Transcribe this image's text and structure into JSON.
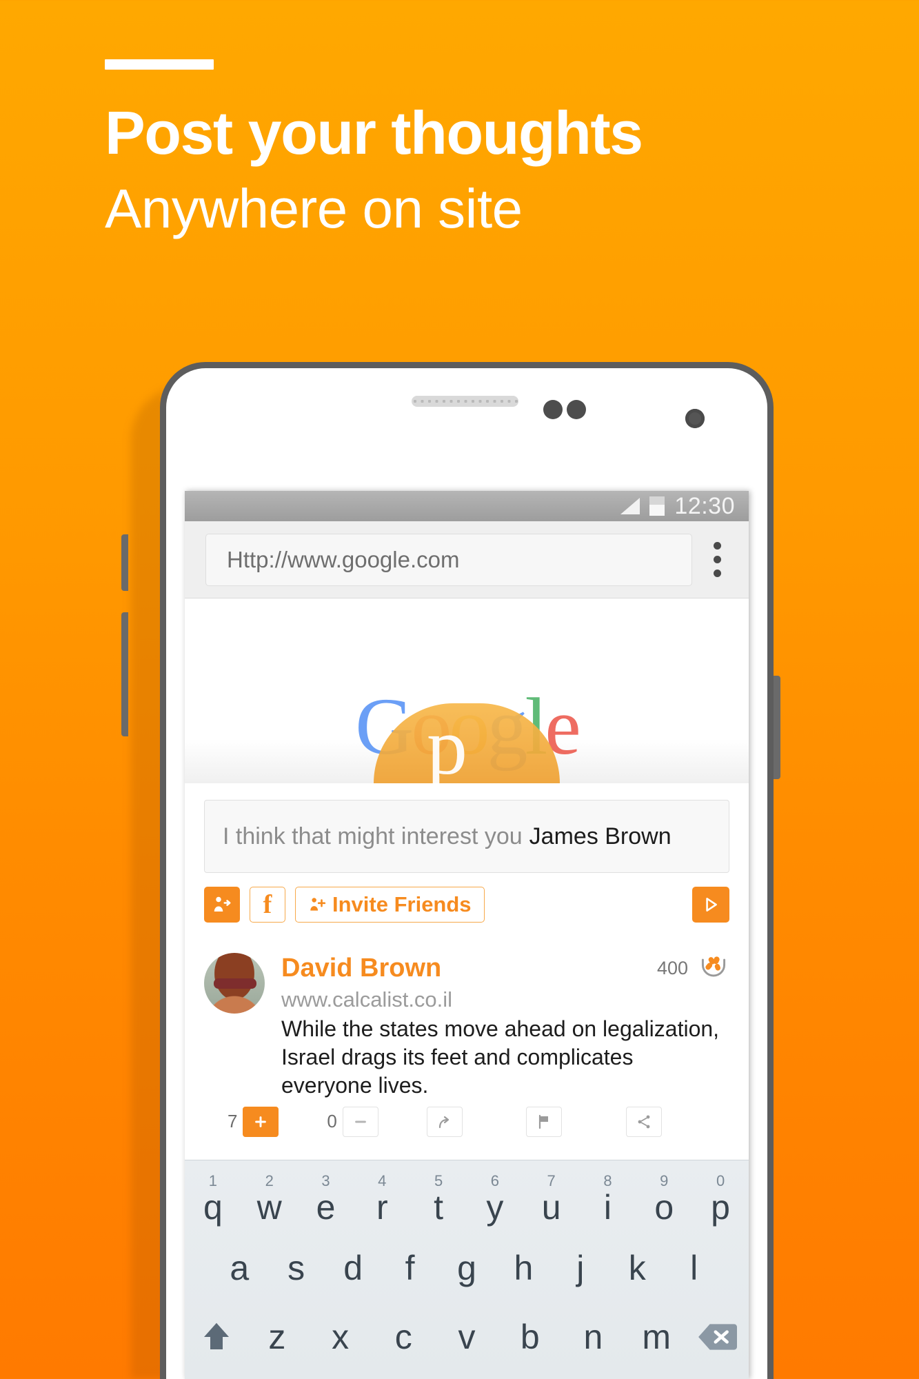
{
  "hero": {
    "rule": "",
    "title": "Post your thoughts",
    "subtitle": "Anywhere on site"
  },
  "phone": {
    "status_bar": {
      "time": "12:30",
      "signal_icon": "signal-triangle-icon",
      "battery_icon": "battery-icon"
    },
    "browser": {
      "url_value": "Http://www.google.com",
      "url_placeholder": "Http://www.google.com",
      "menu_icon": "overflow-menu-icon"
    },
    "page": {
      "logo_letters": [
        "G",
        "o",
        "o",
        "g",
        "l",
        "e"
      ],
      "brand_letter": "p"
    },
    "compose": {
      "placeholder_text": "I think that might interest you",
      "mention": "James Brown"
    },
    "actions": {
      "add_friend_icon": "person-arrow-icon",
      "facebook_label": "f",
      "invite_icon": "person-plus-icon",
      "invite_label": "Invite Friends",
      "send_icon": "send-play-icon"
    },
    "post": {
      "avatar": "user-avatar",
      "author": "David Brown",
      "score": "400",
      "score_icon": "popcorn-bowl-icon",
      "url": "www.calcalist.co.il",
      "text_line_1": "While the states move ahead on legalization,",
      "text_line_2": "Israel drags its feet and complicates everyone lives.",
      "actions": [
        {
          "name": "upvote",
          "count": "7",
          "icon": "plus-icon",
          "filled": true
        },
        {
          "name": "downvote",
          "count": "0",
          "icon": "minus-icon",
          "filled": false
        },
        {
          "name": "reply",
          "count": "",
          "icon": "reply-arrow-icon",
          "filled": false
        },
        {
          "name": "flag",
          "count": "",
          "icon": "flag-icon",
          "filled": false
        },
        {
          "name": "share",
          "count": "",
          "icon": "share-icon",
          "filled": false
        }
      ]
    },
    "keyboard": {
      "row1": [
        {
          "num": "1",
          "ltr": "q"
        },
        {
          "num": "2",
          "ltr": "w"
        },
        {
          "num": "3",
          "ltr": "e"
        },
        {
          "num": "4",
          "ltr": "r"
        },
        {
          "num": "5",
          "ltr": "t"
        },
        {
          "num": "6",
          "ltr": "y"
        },
        {
          "num": "7",
          "ltr": "u"
        },
        {
          "num": "8",
          "ltr": "i"
        },
        {
          "num": "9",
          "ltr": "o"
        },
        {
          "num": "0",
          "ltr": "p"
        }
      ],
      "row2": [
        "a",
        "s",
        "d",
        "f",
        "g",
        "h",
        "j",
        "k",
        "l"
      ],
      "row3": [
        "z",
        "x",
        "c",
        "v",
        "b",
        "n",
        "m"
      ],
      "shift_icon": "shift-arrow-icon",
      "backspace_icon": "backspace-icon"
    }
  },
  "colors": {
    "brand_orange": "#F68B1F",
    "bg_top": "#FFA800",
    "bg_bottom": "#FF7A00",
    "text_white": "#FFFFFF"
  }
}
